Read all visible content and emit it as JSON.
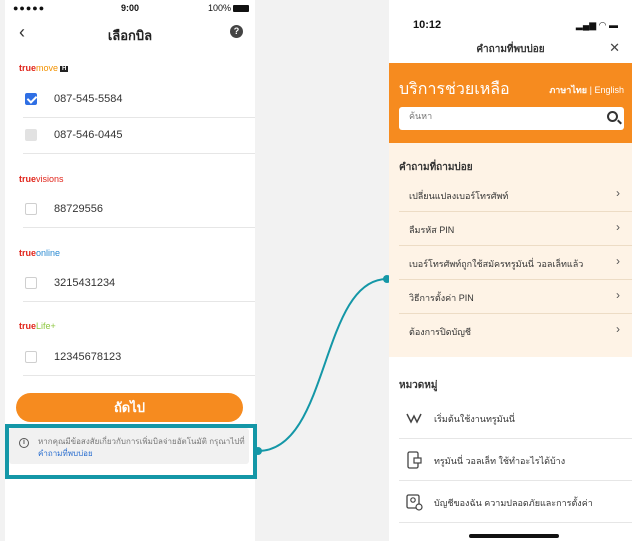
{
  "left": {
    "status": {
      "signal": "●●●●● ",
      "time": "9:00",
      "battery": "100%"
    },
    "nav": {
      "back": "‹",
      "title": "เลือกบิล",
      "help": "?"
    },
    "groups": [
      {
        "brand_a": "true",
        "brand_b": "move",
        "brand_tag": "H",
        "style": "move",
        "rows": [
          {
            "number": "087-545-5584",
            "state": "checked"
          },
          {
            "number": "087-546-0445",
            "state": "disabled"
          }
        ]
      },
      {
        "brand_a": "true",
        "brand_b": "visions",
        "style": "visions",
        "rows": [
          {
            "number": "88729556",
            "state": "unchecked"
          }
        ]
      },
      {
        "brand_a": "true",
        "brand_b": "online",
        "style": "online",
        "rows": [
          {
            "number": "3215431234",
            "state": "unchecked"
          }
        ]
      },
      {
        "brand_a": "true",
        "brand_b": "Life+",
        "style": "life",
        "rows": [
          {
            "number": "12345678123",
            "state": "unchecked"
          }
        ]
      }
    ],
    "next_button": "ถัดไป",
    "info": {
      "icon": "i",
      "text": "หากคุณมีข้อสงสัยเกี่ยวกับการเพิ่มบิลจ่ายอัตโนมัติ กรุณาไปที่",
      "link": "คำถามที่พบบ่อย"
    }
  },
  "right": {
    "status": {
      "time": "10:12",
      "icons": "▂▄▆ ◠ ▬"
    },
    "nav": {
      "title": "คำถามที่พบบ่อย",
      "close": "✕"
    },
    "header": {
      "title": "บริการช่วยเหลือ",
      "lang_th": "ภาษาไทย",
      "lang_sep": "|",
      "lang_en": "English"
    },
    "search": {
      "placeholder": "ค้นหา"
    },
    "faq": {
      "heading": "คำถามที่ถามบ่อย",
      "items": [
        "เปลี่ยนแปลงเบอร์โทรศัพท์",
        "ลืมรหัส PIN",
        "เบอร์โทรศัพท์ถูกใช้สมัครทรูมันนี่ วอลเล็ทแล้ว",
        "วิธีการตั้งค่า PIN",
        "ต้องการปิดบัญชี"
      ],
      "chevron": "›"
    },
    "categories": {
      "heading": "หมวดหมู่",
      "items": [
        {
          "label": "เริ่มต้นใช้งานทรูมันนี่",
          "icon": "wallet-icon"
        },
        {
          "label": "ทรูมันนี่ วอลเล็ท ใช้ทำอะไรได้บ้าง",
          "icon": "phone-wallet-icon"
        },
        {
          "label": "บัญชีของฉัน ความปลอดภัยและการตั้งค่า",
          "icon": "account-security-icon"
        }
      ]
    }
  },
  "colors": {
    "accent": "#f68b1f",
    "highlight": "#1497a7",
    "link": "#2b6fd0",
    "check": "#2f6fe4"
  }
}
